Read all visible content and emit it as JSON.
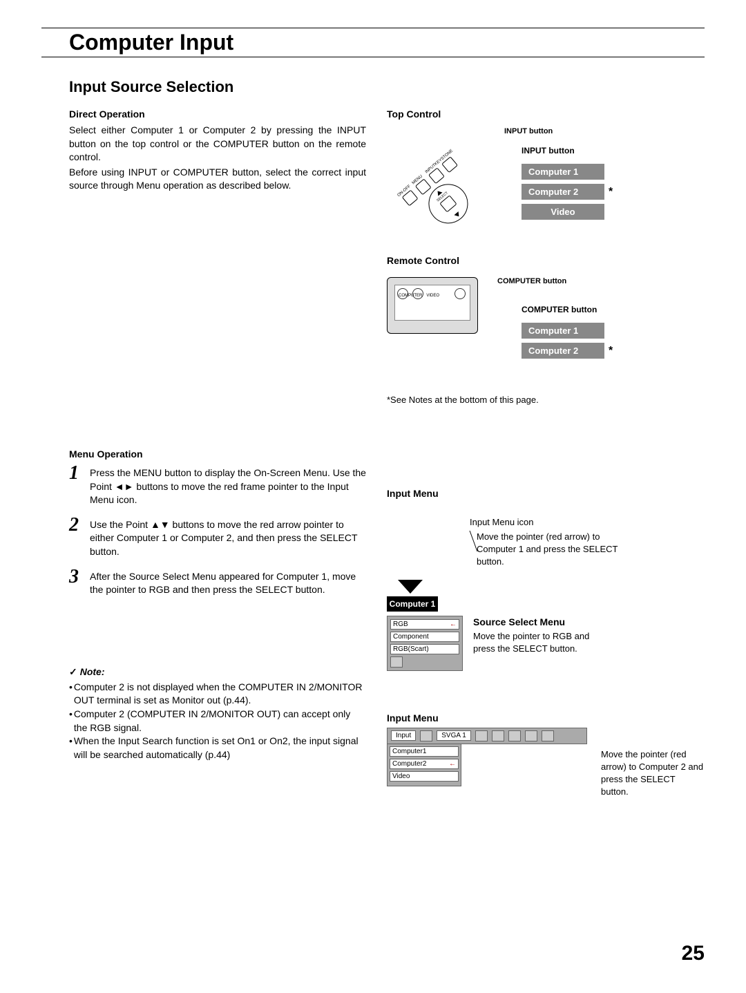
{
  "page_title": "Computer Input",
  "section_title": "Input Source Selection",
  "direct_op": {
    "heading": "Direct Operation",
    "para1": "Select either Computer 1 or Computer 2 by pressing the INPUT button on the top control or the COMPUTER button on the remote control.",
    "para2": "Before using INPUT or COMPUTER button, select the correct input source through Menu operation as described below."
  },
  "top_control": {
    "heading": "Top Control",
    "label_small": "INPUT button",
    "label": "INPUT button",
    "diag_labels": {
      "onoff": "ON-OFF",
      "menu": "MENU",
      "input": "INPUT",
      "keystone": "KEYSTONE",
      "select": "SELECT"
    },
    "options": [
      "Computer 1",
      "Computer 2",
      "Video"
    ],
    "asterisk": "*"
  },
  "remote": {
    "heading": "Remote Control",
    "label_small": "COMPUTER button",
    "label": "COMPUTER button",
    "btn_labels": {
      "computer": "COMPUTER",
      "video": "VIDEO"
    },
    "options": [
      "Computer 1",
      "Computer 2"
    ],
    "asterisk": "*"
  },
  "footnote": "*See Notes at the bottom of this page.",
  "menu_op": {
    "heading": "Menu Operation",
    "steps": [
      "Press the MENU button to display the On-Screen Menu. Use the Point ◄► buttons to move the red frame pointer to the Input Menu icon.",
      "Use the Point ▲▼ buttons to move the red arrow pointer to either Computer 1 or Computer 2, and then press the SELECT button.",
      "After the Source Select Menu appeared for Computer 1, move the pointer to RGB and then press the SELECT button."
    ]
  },
  "input_menu": {
    "heading": "Input Menu",
    "icon_label": "Input Menu icon",
    "caption1": "Move the pointer (red arrow) to Computer 1 and press the SELECT button.",
    "computer_box": "Computer 1",
    "source_heading": "Source Select Menu",
    "source_caption": "Move the pointer to RGB and press the SELECT button.",
    "source_items": [
      "RGB",
      "Component",
      "RGB(Scart)"
    ],
    "arrow": "←"
  },
  "input_menu2": {
    "heading": "Input Menu",
    "top_label": "Input",
    "mode": "SVGA 1",
    "items": [
      "Computer1",
      "Computer2",
      "Video"
    ],
    "arrow": "←",
    "caption": "Move the pointer (red arrow) to Computer 2 and press the SELECT button."
  },
  "note": {
    "heading": "Note:",
    "bullets": [
      "Computer 2 is not displayed when the COMPUTER IN 2/MONITOR OUT terminal is set as Monitor out (p.44).",
      "Computer 2 (COMPUTER IN 2/MONITOR OUT) can accept only the RGB signal.",
      " When the Input Search function is set On1 or On2, the input signal will be searched automatically (p.44)"
    ]
  },
  "page_number": "25"
}
